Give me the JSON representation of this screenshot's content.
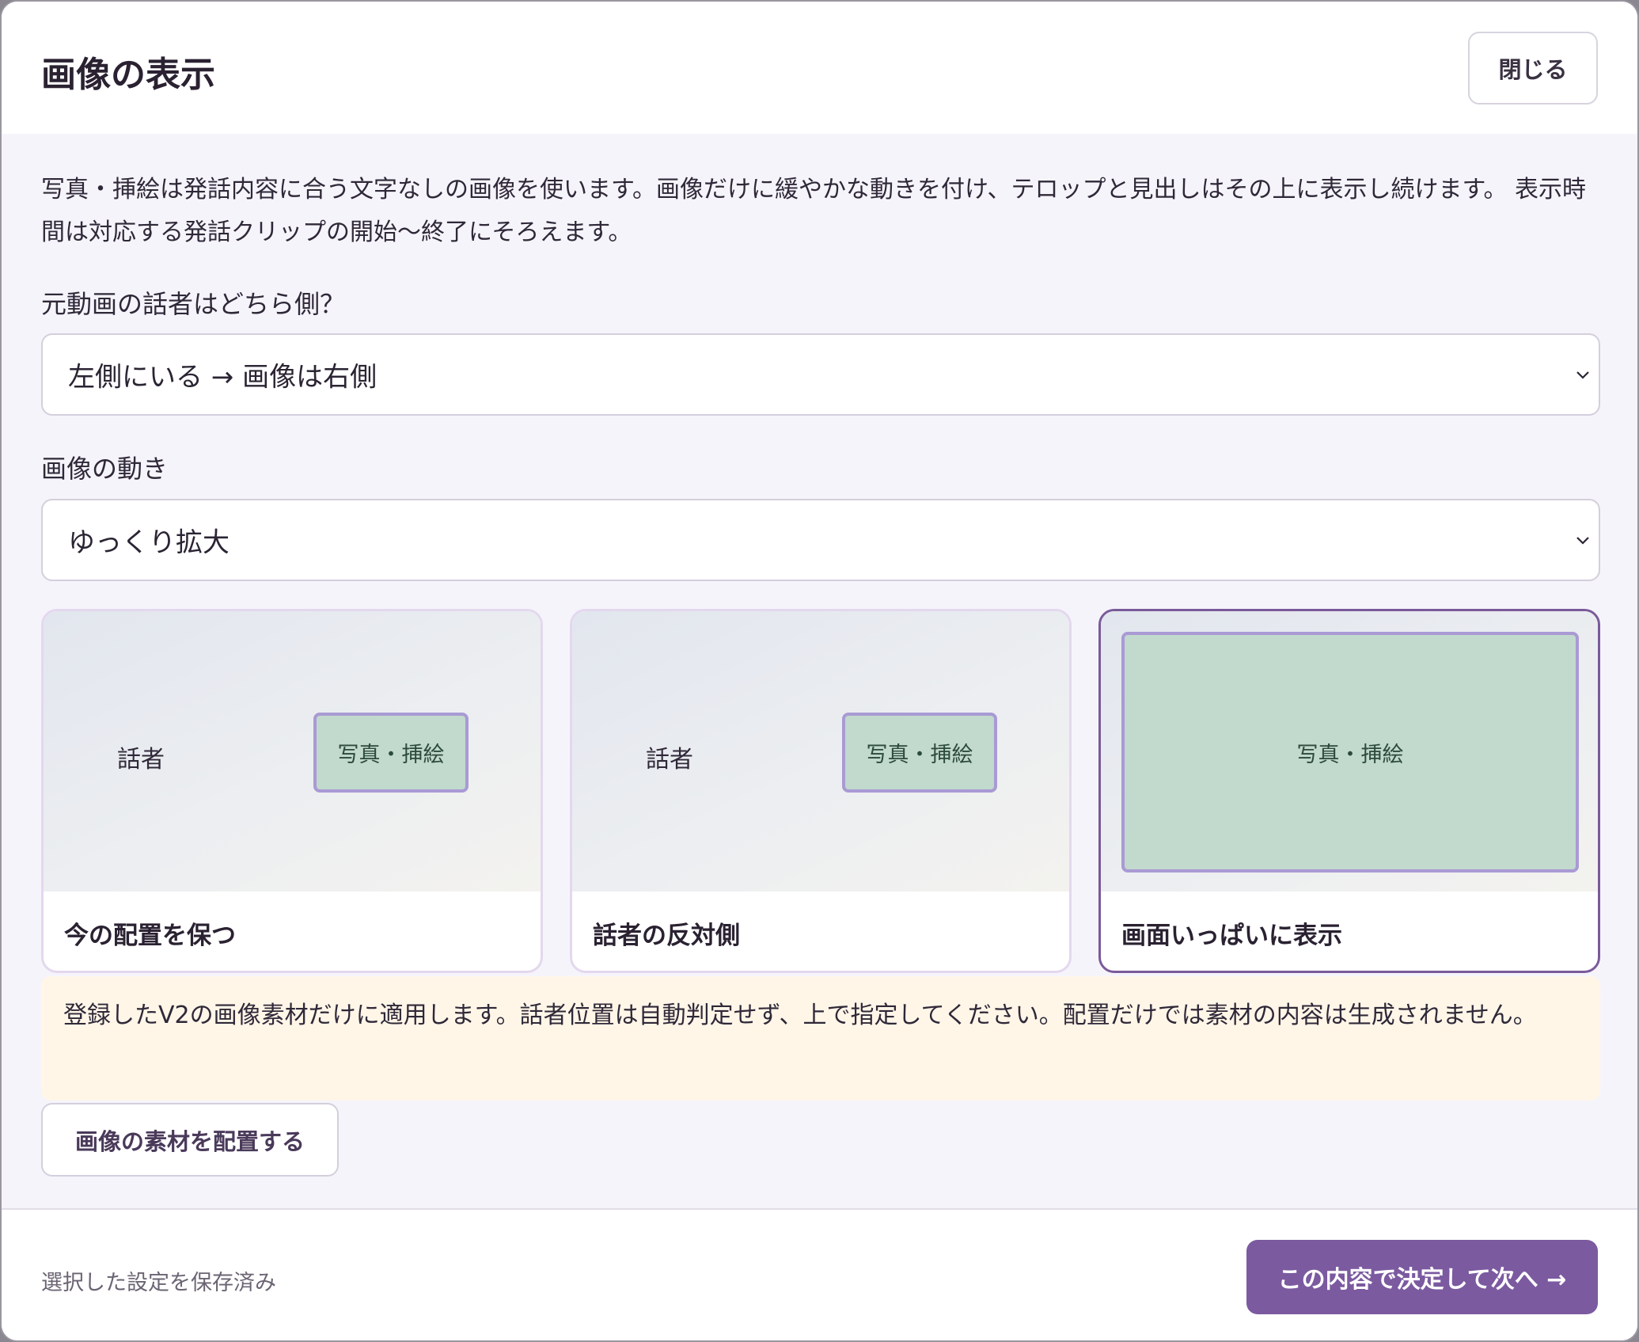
{
  "dialog": {
    "title": "画像の表示",
    "close_label": "閉じる"
  },
  "description": "写真・挿絵は発話内容に合う文字なしの画像を使います。画像だけに緩やかな動きを付け、テロップと見出しはその上に表示し続けます。 表示時間は対応する発話クリップの開始〜終了にそろえます。",
  "speaker_side": {
    "label": "元動画の話者はどちら側？",
    "value": "左側にいる → 画像は右側"
  },
  "motion": {
    "label": "画像の動き",
    "value": "ゆっくり拡大"
  },
  "layout_options": [
    {
      "caption": "今の配置を保つ",
      "speaker": "話者",
      "image": "写真・挿絵",
      "selected": false
    },
    {
      "caption": "話者の反対側",
      "speaker": "話者",
      "image": "写真・挿絵",
      "selected": false
    },
    {
      "caption": "画面いっぱいに表示",
      "image": "写真・挿絵",
      "selected": true
    }
  ],
  "note": "登録したV2の画像素材だけに適用します。話者位置は自動判定せず、上で指定してください。配置だけでは素材の内容は生成されません。",
  "place_button_label": "画像の素材を配置する",
  "footer": {
    "status": "選択した設定を保存済み",
    "next_label": "この内容で決定して次へ →"
  },
  "colors": {
    "accent": "#7b5aa0",
    "selected_border": "#7a5a9a",
    "image_fill": "#c2d9cd",
    "image_border": "#a99ad4",
    "note_background": "#fff6e8"
  },
  "icons": {
    "select_chevron": "chevron-down-icon"
  }
}
